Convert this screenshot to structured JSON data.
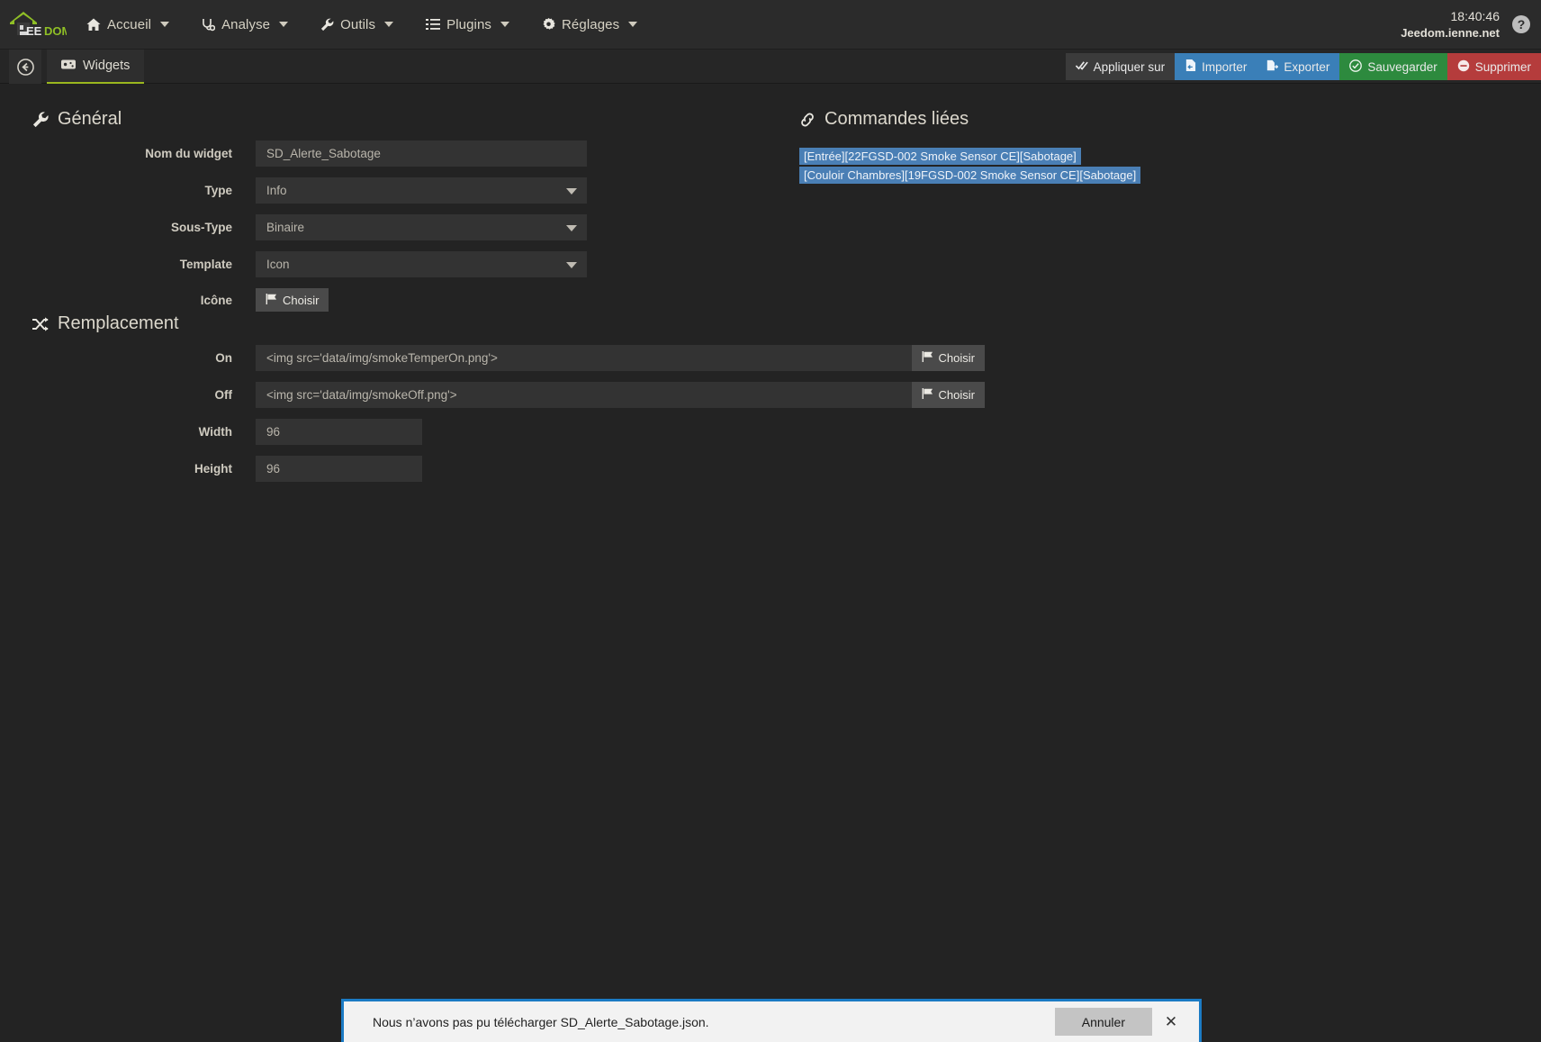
{
  "topbar": {
    "brand": "JEEDOM",
    "brand_parts": {
      "jee": "EE",
      "dom": "DOM"
    },
    "menu": [
      {
        "label": "Accueil",
        "icon": "home-icon"
      },
      {
        "label": "Analyse",
        "icon": "stethoscope-icon"
      },
      {
        "label": "Outils",
        "icon": "wrench-icon"
      },
      {
        "label": "Plugins",
        "icon": "list-icon"
      },
      {
        "label": "Réglages",
        "icon": "gear-icon"
      }
    ],
    "time": "18:40:46",
    "host": "Jeedom.ienne.net",
    "help": "?"
  },
  "subbar": {
    "back": "back-arrow",
    "tab_label": "Widgets",
    "tab_icon": "widget-icon",
    "buttons": [
      {
        "label": "Appliquer sur",
        "icon": "check-double-icon",
        "style": "default"
      },
      {
        "label": "Importer",
        "icon": "import-icon",
        "style": "info"
      },
      {
        "label": "Exporter",
        "icon": "export-icon",
        "style": "info"
      },
      {
        "label": "Sauvegarder",
        "icon": "check-circle-icon",
        "style": "success"
      },
      {
        "label": "Supprimer",
        "icon": "minus-circle-icon",
        "style": "danger"
      }
    ]
  },
  "general": {
    "legend": "Général",
    "legend_icon": "wrench-icon",
    "fields": {
      "name_label": "Nom du widget",
      "name_value": "SD_Alerte_Sabotage",
      "type_label": "Type",
      "type_value": "Info",
      "subtype_label": "Sous-Type",
      "subtype_value": "Binaire",
      "template_label": "Template",
      "template_value": "Icon",
      "icon_label": "Icône",
      "icon_button": "Choisir"
    }
  },
  "replacement": {
    "legend": "Remplacement",
    "legend_icon": "shuffle-icon",
    "on_label": "On",
    "on_value": "<img src='data/img/smokeTemperOn.png'>",
    "on_button": "Choisir",
    "off_label": "Off",
    "off_value": "<img src='data/img/smokeOff.png'>",
    "off_button": "Choisir",
    "width_label": "Width",
    "width_value": "96",
    "height_label": "Height",
    "height_value": "96"
  },
  "linked": {
    "legend": "Commandes liées",
    "legend_icon": "link-icon",
    "items": [
      "[Entrée][22FGSD-002 Smoke Sensor CE][Sabotage]",
      "[Couloir Chambres][19FGSD-002 Smoke Sensor CE][Sabotage]"
    ]
  },
  "notification": {
    "message": "Nous n’avons pas pu télécharger SD_Alerte_Sabotage.json.",
    "cancel_label": "Annuler",
    "close_label": "✕"
  },
  "colors": {
    "accent_green": "#9ab71e",
    "info_blue": "#3a7fb8",
    "success_green": "#2d8a3e",
    "danger_red": "#b53c3c",
    "selection_blue": "#4a7fb5",
    "notif_border": "#1b7bc4"
  }
}
